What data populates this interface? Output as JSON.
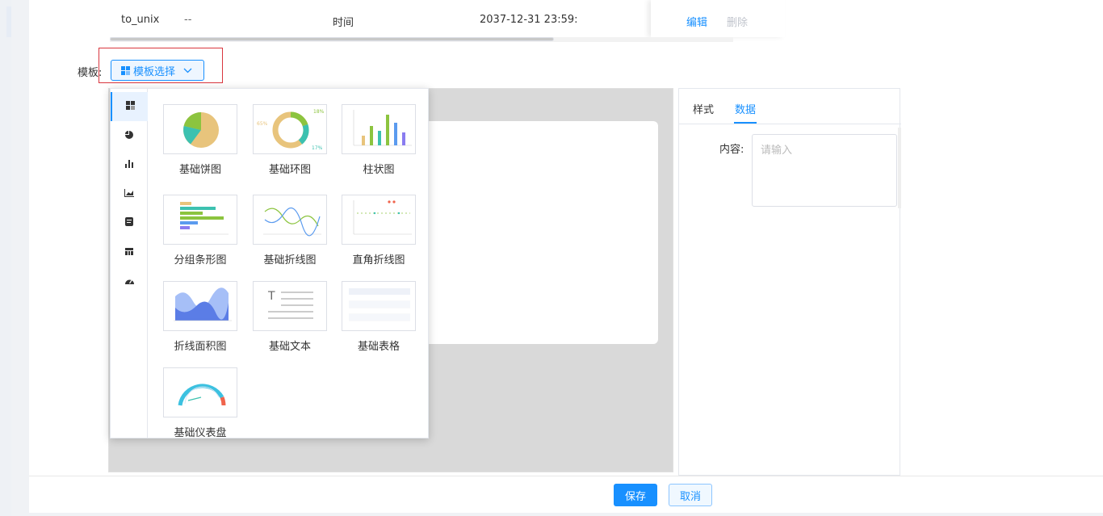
{
  "table": {
    "row": {
      "name": "to_unix",
      "dash": "--",
      "type": "时间",
      "time": "2037-12-31 23:59:",
      "edit": "编辑",
      "delete": "删除"
    }
  },
  "template": {
    "label": "模板:",
    "button": "模板选择"
  },
  "icons": {
    "template_button": "grid-icon",
    "dropdown": "chevron-down-icon"
  },
  "picker": {
    "categories": [
      "grid-icon",
      "pie-icon",
      "bar-icon",
      "area-icon",
      "text-icon",
      "table-icon",
      "gauge-icon"
    ],
    "items": [
      {
        "label": "基础饼图"
      },
      {
        "label": "基础环图",
        "percents": [
          "18%",
          "65%",
          "17%"
        ]
      },
      {
        "label": "柱状图"
      },
      {
        "label": "分组条形图"
      },
      {
        "label": "基础折线图"
      },
      {
        "label": "直角折线图"
      },
      {
        "label": "折线面积图"
      },
      {
        "label": "基础文本"
      },
      {
        "label": "基础表格"
      },
      {
        "label": "基础仪表盘"
      }
    ]
  },
  "panel": {
    "tabs": [
      "样式",
      "数据"
    ],
    "active_tab": "数据",
    "content_label": "内容:",
    "content_placeholder": "请输入"
  },
  "footer": {
    "save": "保存",
    "cancel": "取消"
  },
  "colors": {
    "accent": "#1890ff",
    "pie_green": "#8cc43f",
    "pie_teal": "#3cc1b0",
    "pie_sand": "#e8c47c",
    "highlight_red": "#d9363e"
  }
}
